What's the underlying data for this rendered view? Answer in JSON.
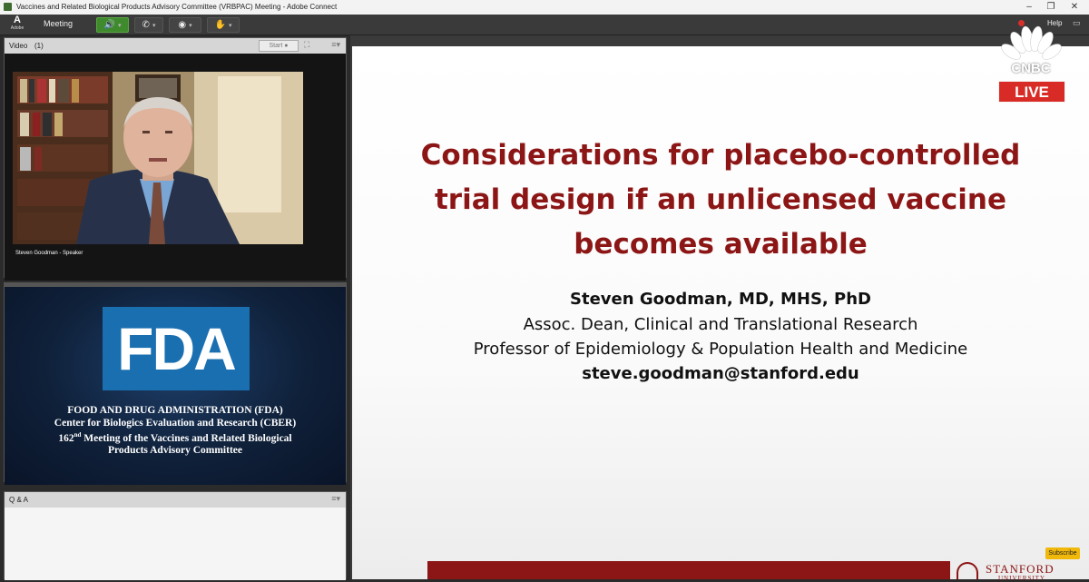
{
  "window": {
    "title": "Vaccines and Related Biological Products Advisory Committee (VRBPAC) Meeting - Adobe Connect"
  },
  "toolbar": {
    "logo_letter": "A",
    "logo_text": "Adobe",
    "meeting_menu": "Meeting",
    "help": "Help"
  },
  "video_pod": {
    "title": "Video",
    "count": "(1)",
    "start_label": "Start",
    "speaker_label": "Steven Goodman - Speaker"
  },
  "fda_pod": {
    "logo": "FDA",
    "line1": "FOOD AND DRUG ADMINISTRATION (FDA)",
    "line2": "Center for Biologics Evaluation and Research (CBER)",
    "line3_num": "162",
    "line3_sup": "nd",
    "line3_rest": " Meeting of the Vaccines and Related Biological",
    "line4": "Products Advisory Committee"
  },
  "qa_pod": {
    "title": "Q & A"
  },
  "slide": {
    "title_line1": "Considerations for placebo-controlled",
    "title_line2": "trial design if an unlicensed vaccine",
    "title_line3": "becomes available",
    "presenter_name": "Steven Goodman, MD, MHS, PhD",
    "role_line1": "Assoc. Dean, Clinical and Translational Research",
    "role_line2": "Professor of Epidemiology & Population Health and Medicine",
    "email": "steve.goodman@stanford.edu",
    "footer_logo_word": "STANFORD",
    "footer_logo_sub": "UNIVERSITY"
  },
  "overlay": {
    "network": "CNBC",
    "live": "LIVE",
    "subscribe": "Subscribe"
  },
  "colors": {
    "stanford_red": "#8c1515",
    "fda_blue": "#1a6fb0",
    "live_red": "#d92b25",
    "toolbar_bg": "#3a3a3a",
    "audio_green": "#3f8a2c"
  },
  "icons": [
    "speaker-icon",
    "phone-icon",
    "webcam-icon",
    "raise-hand-icon",
    "fullscreen-icon",
    "pod-menu-icon",
    "minimize-icon",
    "maximize-icon",
    "close-icon",
    "peacock-icon"
  ]
}
